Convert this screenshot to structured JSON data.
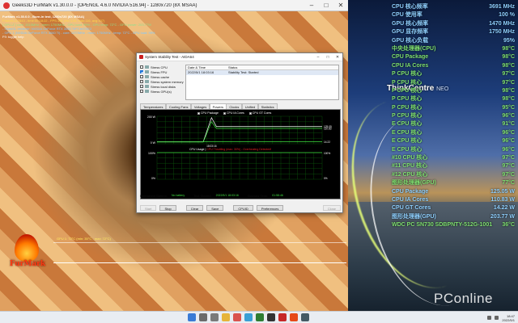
{
  "furmark": {
    "window_title": "Geeks3D FurMark v1.30.0.0 - [OPENGL 4.6.0 NVIDIA 516.94] - 1280x720 (8X MSAA)",
    "overlay_lines": [
      "FurMark v1.30.0.0 - Burn-in test, 1280x720 (8X MSAA)",
      "Frames:117843 - time:00:18:22 - FPS:108 (min:105, max:116, avg:107)",
      "[ GPU-Z ] core: 1515MHz - mem: 1750MHz - GPU load: 99% - GPU temp: 72°C - GPU power: 203.77W",
      "- OpenGL renderer: NVIDIA GeForce RTX 3060 Ti/PCIe/SSE2",
      "- GPU 1 (NVIDIA GeForce RTX 3060 Ti) - core: 1470MHz - mem: 1750MHz - temp: 72°C - GPU load: 99%",
      "F9: toggle help"
    ],
    "logo_text": "FurMark",
    "graph_label": "GPU 1: 72°C (min: 35°C - max: 72°C)"
  },
  "osd": {
    "rows": [
      {
        "label": "CPU 核心频率",
        "value": "3691 MHz",
        "color": "#8fd0ff"
      },
      {
        "label": "CPU 使用率",
        "value": "100 %",
        "color": "#8fd0ff"
      },
      {
        "label": "GPU 核心频率",
        "value": "1470 MHz",
        "color": "#8fd0ff"
      },
      {
        "label": "GPU 显存频率",
        "value": "1750 MHz",
        "color": "#8fd0ff"
      },
      {
        "label": "GPU 核心负载",
        "value": "95%",
        "color": "#8fd0ff"
      },
      {
        "label": "中央处理器(CPU)",
        "value": "98°C",
        "color": "#7fe070"
      },
      {
        "label": "CPU Package",
        "value": "98°C",
        "color": "#7fe070"
      },
      {
        "label": "CPU IA Cores",
        "value": "98°C",
        "color": "#7fe070"
      },
      {
        "label": "P CPU 核心",
        "value": "97°C",
        "color": "#7fe070"
      },
      {
        "label": "P CPU 核心",
        "value": "97°C",
        "color": "#7fe070"
      },
      {
        "label": "P CPU 核心",
        "value": "98°C",
        "color": "#7fe070"
      },
      {
        "label": "P CPU 核心",
        "value": "98°C",
        "color": "#7fe070"
      },
      {
        "label": "P CPU 核心",
        "value": "95°C",
        "color": "#7fe070"
      },
      {
        "label": "P CPU 核心",
        "value": "96°C",
        "color": "#7fe070"
      },
      {
        "label": "E CPU 核心",
        "value": "91°C",
        "color": "#7fe070"
      },
      {
        "label": "E CPU 核心",
        "value": "96°C",
        "color": "#7fe070"
      },
      {
        "label": "E CPU 核心",
        "value": "96°C",
        "color": "#7fe070"
      },
      {
        "label": "E CPU 核心",
        "value": "96°C",
        "color": "#7fe070"
      },
      {
        "label": "#10 CPU 核心",
        "value": "97°C",
        "color": "#7fe070"
      },
      {
        "label": "#11 CPU 核心",
        "value": "97°C",
        "color": "#7fe070"
      },
      {
        "label": "#12 CPU 核心",
        "value": "97°C",
        "color": "#7fe070"
      },
      {
        "label": "图形处理器(GPU)",
        "value": "77°C",
        "color": "#7fe070"
      },
      {
        "label": "CPU Package",
        "value": "125.05 W",
        "color": "#8fd0ff"
      },
      {
        "label": "CPU IA Cores",
        "value": "110.83 W",
        "color": "#8fd0ff"
      },
      {
        "label": "CPU GT Cores",
        "value": "14.22 W",
        "color": "#8fd0ff"
      },
      {
        "label": "图形处理器(GPU)",
        "value": "203.77 W",
        "color": "#8fd0ff"
      },
      {
        "label": "WDC PC SN730 SDBPNTY-512G-1001",
        "value": "36°C",
        "color": "#7fe070"
      }
    ]
  },
  "desktop": {
    "thinkcentre": "ThinkCentre",
    "thinkcentre_suffix": "NEO",
    "watermark": "PConline"
  },
  "sst": {
    "title": "System Stability Test - AIDA64",
    "stress_items": [
      {
        "label": "Stress CPU",
        "checked": false
      },
      {
        "label": "Stress FPU",
        "checked": true
      },
      {
        "label": "Stress cache",
        "checked": false
      },
      {
        "label": "Stress system memory",
        "checked": false
      },
      {
        "label": "Stress local disks",
        "checked": false
      },
      {
        "label": "Stress GPU(s)",
        "checked": false
      }
    ],
    "table_headers": [
      "Date & Time",
      "Status"
    ],
    "table_rows": [
      [
        "2022/5/1 18:03:16",
        "Stability Test: Started"
      ]
    ],
    "tabs": [
      "Temperatures",
      "Cooling Fans",
      "Voltages",
      "Powers",
      "Clocks",
      "Unified",
      "Statistics"
    ],
    "active_tab": "Powers",
    "chart_legend": [
      "CPU Package",
      "CPU IA Cores",
      "CPU GT Cores"
    ],
    "cpu_usage_label_a": "CPU Usage",
    "cpu_usage_label_b": "CPU Throttling (max: 30%) - Overheating Detected!",
    "status_labels": {
      "battery": "Remaining Battery:",
      "started": "Test Started:",
      "elapsed": "Elapsed Time:"
    },
    "status_values": {
      "battery": "No battery",
      "started": "2022/5/1 18:03:16",
      "elapsed": "01:58:46"
    },
    "buttons": {
      "start": "Start",
      "stop": "Stop",
      "clear": "Clear",
      "save": "Save",
      "cpuid": "CPUID",
      "preferences": "Preferences",
      "close": "Close"
    }
  },
  "chart_data": [
    {
      "type": "line",
      "title": "",
      "xlabel": "",
      "ylabel": "",
      "ylim": [
        0,
        200
      ],
      "y_tick_labels": [
        "200 W",
        "0 W"
      ],
      "x_tick_labels": [
        "18:03:16"
      ],
      "series": [
        {
          "name": "CPU Package",
          "color": "#ffffff",
          "x": [
            0,
            0.28,
            0.33,
            0.36,
            0.45,
            1.0
          ],
          "y": [
            14,
            14,
            190,
            125,
            125,
            125
          ]
        },
        {
          "name": "CPU IA Cores",
          "color": "#3fe03f",
          "x": [
            0,
            0.28,
            0.33,
            0.36,
            0.45,
            1.0
          ],
          "y": [
            12,
            12,
            160,
            111,
            111,
            111
          ]
        },
        {
          "name": "CPU GT Cores",
          "color": "#3fe03f",
          "x": [
            0,
            1.0
          ],
          "y": [
            14,
            14
          ]
        }
      ],
      "right_labels": [
        "125.05",
        "110.83",
        "14.22"
      ],
      "grid": true
    },
    {
      "type": "line",
      "title": "CPU Usage | CPU Throttling (max: 30%) - Overheating Detected!",
      "xlabel": "",
      "ylabel": "",
      "ylim": [
        0,
        100
      ],
      "y_tick_labels": [
        "100%",
        "0%"
      ],
      "right_labels": [
        "100%",
        "0%"
      ],
      "series": [
        {
          "name": "CPU Usage",
          "color": "#3fe03f",
          "x": [
            0,
            1
          ],
          "y": [
            100,
            100
          ]
        }
      ],
      "grid": true
    }
  ],
  "taskbar": {
    "time": "18:47",
    "date": "2022/5/1",
    "icon_colors": [
      "#3a7bd5",
      "#6b6b6b",
      "#7a7a7a",
      "#e6b43a",
      "#d9534f",
      "#3aa0d5",
      "#2e7d32",
      "#333333",
      "#c62828",
      "#e64a19",
      "#455a64"
    ]
  }
}
